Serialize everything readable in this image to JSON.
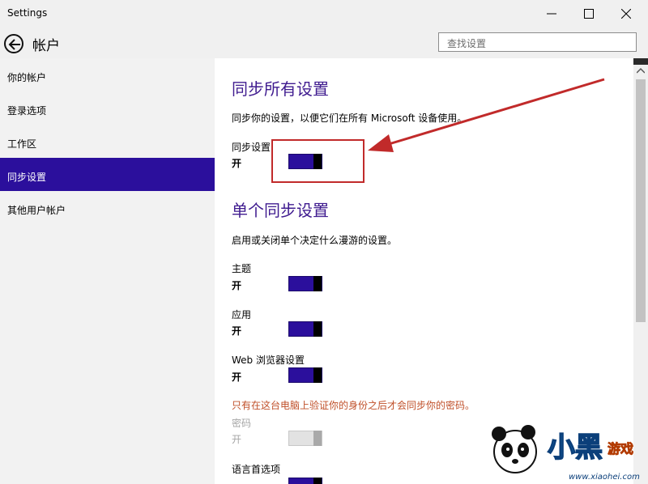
{
  "window": {
    "title": "Settings",
    "minimize_icon": "minimize-icon",
    "maximize_icon": "maximize-icon",
    "close_icon": "close-icon"
  },
  "header": {
    "back_icon": "back-arrow-icon",
    "title": "帐户",
    "search_placeholder": "查找设置"
  },
  "sidebar": {
    "items": [
      {
        "label": "你的帐户",
        "active": false
      },
      {
        "label": "登录选项",
        "active": false
      },
      {
        "label": "工作区",
        "active": false
      },
      {
        "label": "同步设置",
        "active": true
      },
      {
        "label": "其他用户帐户",
        "active": false
      }
    ]
  },
  "main": {
    "sync_all": {
      "title": "同步所有设置",
      "description": "同步你的设置，以便它们在所有 Microsoft 设备使用。",
      "toggle_label": "同步设置",
      "toggle_state": "开",
      "toggle_on": true
    },
    "individual": {
      "title": "单个同步设置",
      "description": "启用或关闭单个决定什么漫游的设置。",
      "items": [
        {
          "label": "主题",
          "state": "开",
          "on": true,
          "enabled": true
        },
        {
          "label": "应用",
          "state": "开",
          "on": true,
          "enabled": true
        },
        {
          "label": "Web 浏览器设置",
          "state": "开",
          "on": true,
          "enabled": true
        }
      ],
      "password_warning": "只有在这台电脑上验证你的身份之后才会同步你的密码。",
      "password": {
        "label": "密码",
        "state": "开",
        "on": true,
        "enabled": false
      },
      "language": {
        "label": "语言首选项"
      }
    }
  },
  "colors": {
    "accent": "#2b0f9c",
    "heading": "#3f1b8f",
    "warning": "#c0502a",
    "annotation": "#c12a2a"
  },
  "watermark": {
    "text_main": "小黑",
    "text_sub": "游戏",
    "url": "www.xiaohei.com"
  }
}
